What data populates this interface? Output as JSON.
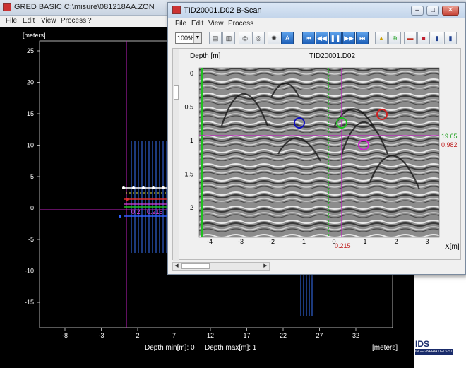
{
  "main_window": {
    "title": "GRED BASIC C:\\misure\\081218AA.ZON",
    "menu": [
      "File",
      "Edit",
      "View",
      "Process",
      "?"
    ],
    "y_axis_unit": "[meters]",
    "x_axis_unit": "[meters]",
    "y_ticks": [
      "25",
      "20",
      "15",
      "10",
      "5",
      "0",
      "-5",
      "-10",
      "-15"
    ],
    "x_ticks": [
      "-8",
      "-3",
      "2",
      "7",
      "12",
      "17",
      "22",
      "27",
      "32"
    ],
    "overlay_text_a": "0.2",
    "overlay_text_b": "0.215",
    "depth_min": "Depth min[m]: 0",
    "depth_max": "Depth max[m]: 1",
    "logo_text": "IDS",
    "logo_subtext": "INGEGNERIA DEI SISTEMI"
  },
  "bscan_window": {
    "title": "TID20001.D02  B-Scan",
    "menu": [
      "File",
      "Edit",
      "View",
      "Process"
    ],
    "zoom_value": "100%",
    "plot_title": "TID20001.D02",
    "y_label": "Depth [m]",
    "x_label": "X[m]",
    "y_ticks": [
      "0",
      "0.5",
      "1",
      "1.5",
      "2"
    ],
    "x_ticks": [
      "-4",
      "-3",
      "-2",
      "-1",
      "0",
      "1",
      "2",
      "3"
    ],
    "cursor_x_value": "0.215",
    "cursor_y_value_green": "19.65",
    "cursor_y_value_red": "0.982",
    "toolbar_icons": [
      "zoom-select",
      "copy-icon",
      "paste-icon",
      "binoculars-icon",
      "binoculars-2-icon",
      "color-wheel-icon",
      "text-a-icon",
      "first-icon",
      "rewind-icon",
      "pause-icon",
      "forward-icon",
      "last-icon",
      "warning-triangle-icon",
      "target-icon",
      "layers-icon",
      "ids-flag-icon",
      "marker-icon",
      "settings-icon"
    ]
  },
  "colors": {
    "magenta_cursor": "#c020c0",
    "green_cursor": "#20c020",
    "trace_blue": "#3060d0",
    "marker_blue": "#1010c0",
    "marker_green": "#20c020",
    "marker_red": "#d02020",
    "marker_magenta": "#d020d0"
  }
}
